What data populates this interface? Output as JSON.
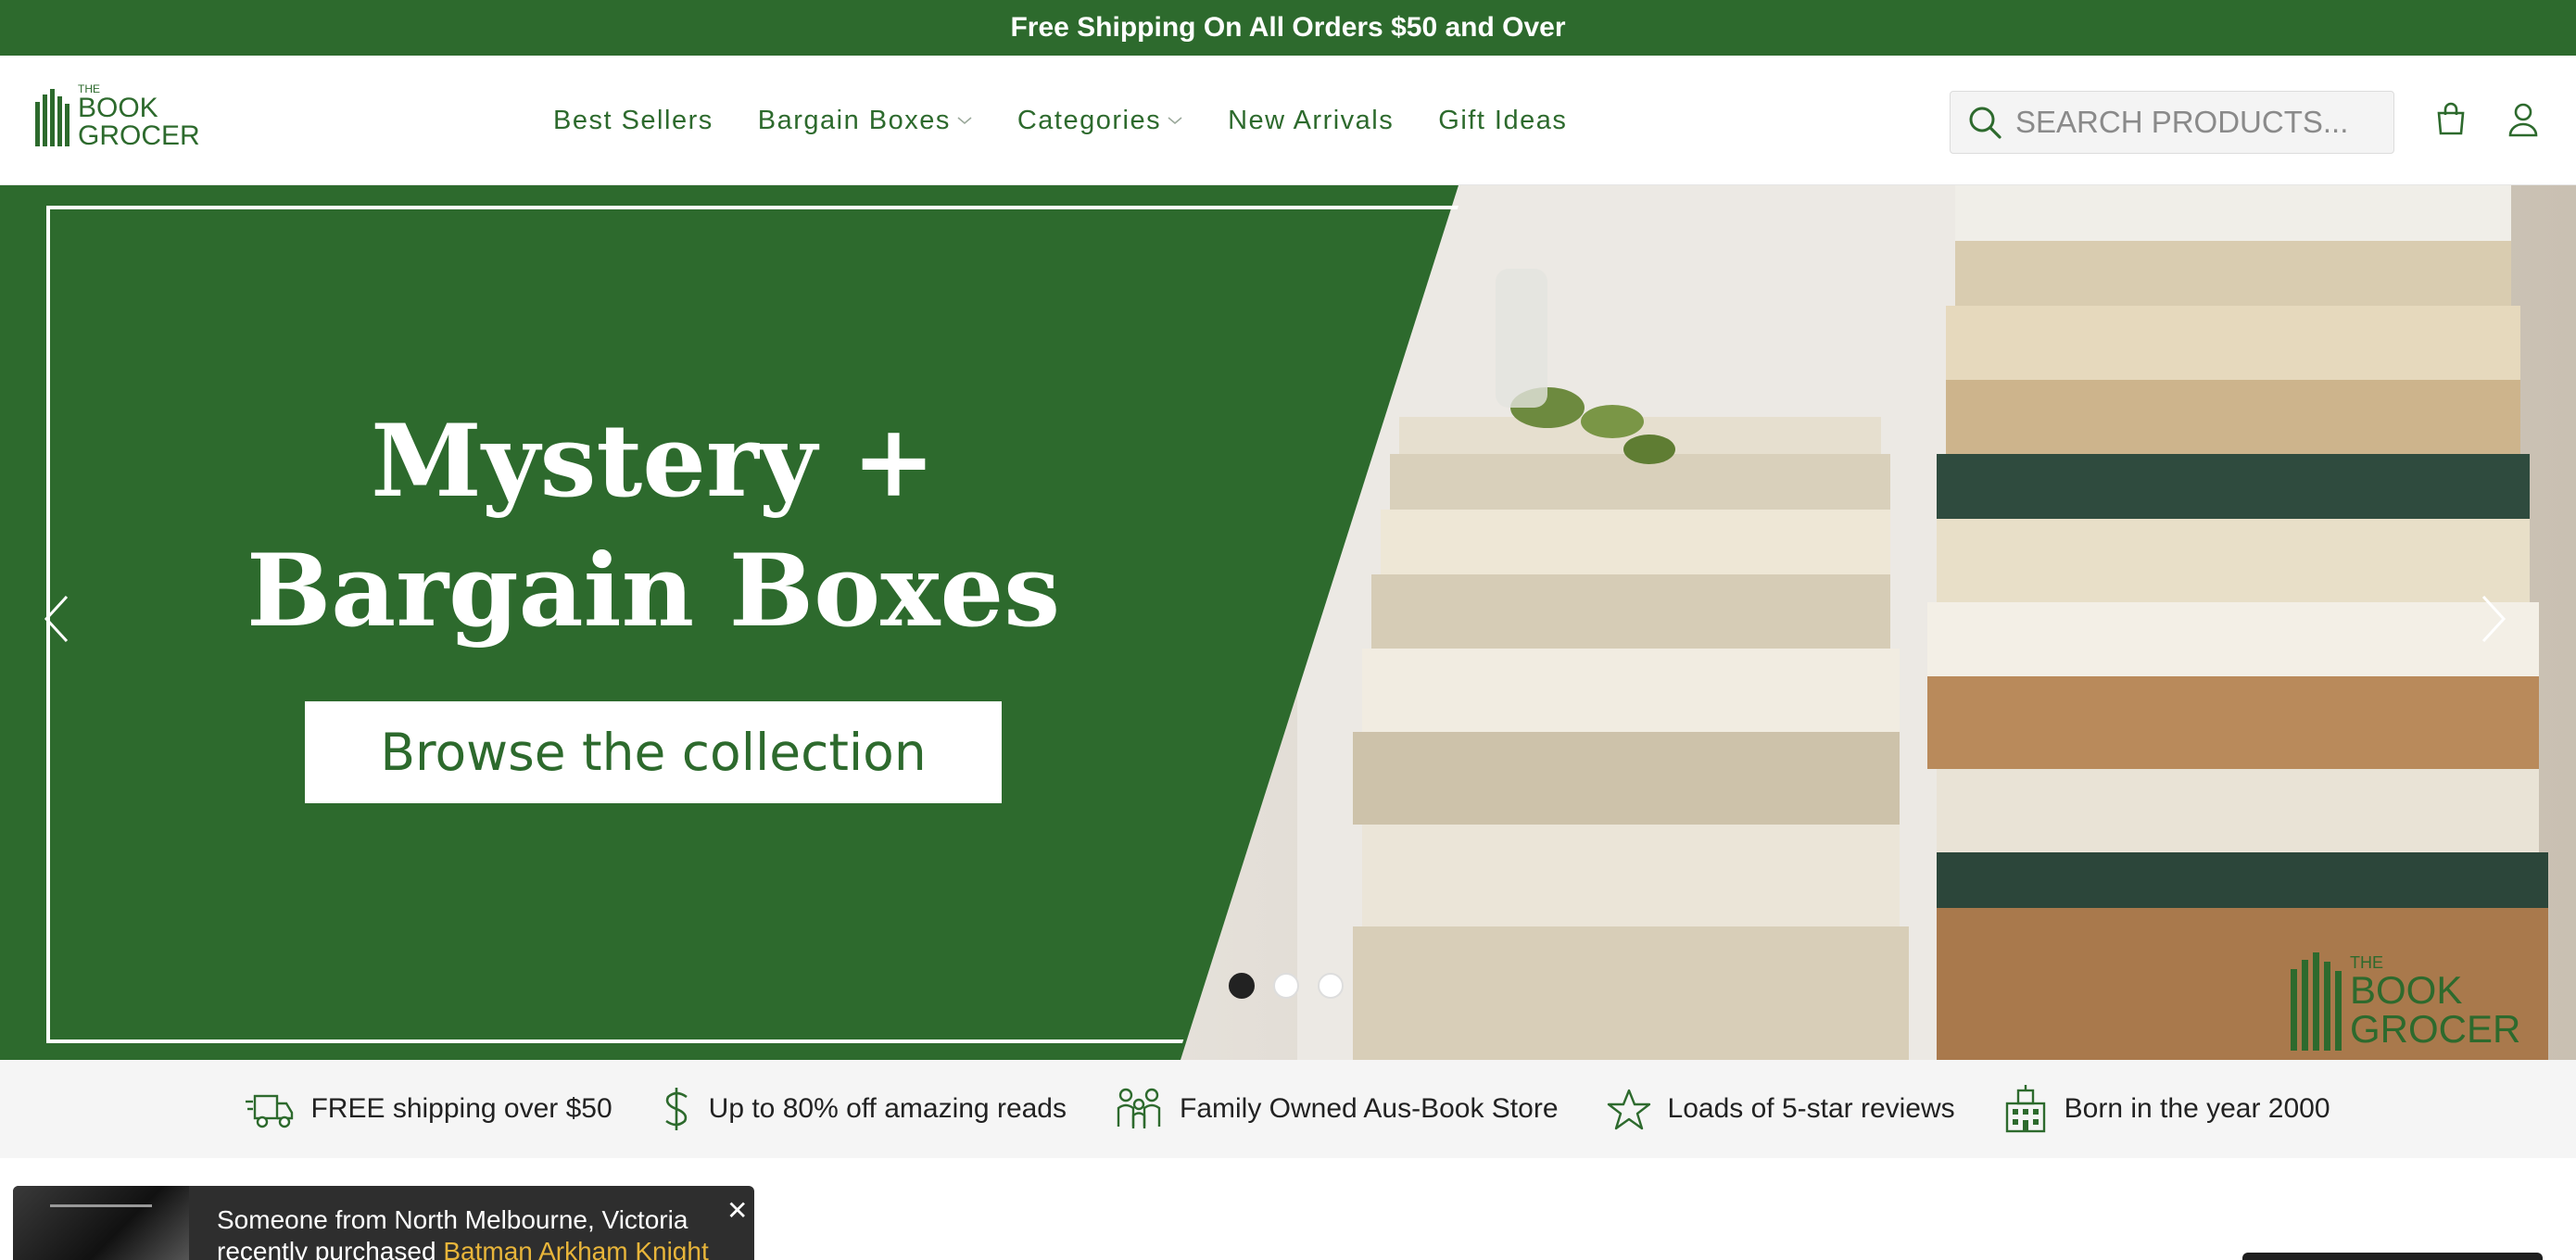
{
  "announcement": {
    "text": "Free Shipping On All Orders $50 and Over"
  },
  "logo": {
    "small": "THE",
    "line1": "BOOK",
    "line2": "GROCER"
  },
  "nav": {
    "items": [
      {
        "label": "Best Sellers",
        "dropdown": false
      },
      {
        "label": "Bargain Boxes",
        "dropdown": true
      },
      {
        "label": "Categories",
        "dropdown": true
      },
      {
        "label": "New Arrivals",
        "dropdown": false
      },
      {
        "label": "Gift Ideas",
        "dropdown": false
      }
    ]
  },
  "search": {
    "placeholder": "SEARCH PRODUCTS..."
  },
  "header_icons": [
    "shopping-bag-icon",
    "user-icon"
  ],
  "hero": {
    "title_line1": "Mystery +",
    "title_line2": "Bargain Boxes",
    "cta_label": "Browse the collection",
    "slide_count": 3,
    "active_slide": 1,
    "photo_logo": {
      "small": "THE",
      "line1": "BOOK",
      "line2": "GROCER"
    }
  },
  "features": [
    {
      "icon": "delivery-truck-icon",
      "text": "FREE shipping over $50"
    },
    {
      "icon": "dollar-icon",
      "text": "Up to 80% off amazing reads"
    },
    {
      "icon": "family-icon",
      "text": "Family Owned Aus-Book Store"
    },
    {
      "icon": "star-icon",
      "text": "Loads of 5-star reviews"
    },
    {
      "icon": "building-icon",
      "text": "Born in the year 2000"
    }
  ],
  "notification": {
    "line1": "Someone from North Melbourne, Victoria",
    "line2_prefix": "recently purchased",
    "product": "Batman Arkham Knight"
  },
  "colors": {
    "brand_green": "#2d6a2d",
    "announcement_bg": "#2d6a2d",
    "feature_strip_bg": "#f5f5f5",
    "notification_bg": "#2e2e2e",
    "notification_link": "#e8b53a"
  }
}
